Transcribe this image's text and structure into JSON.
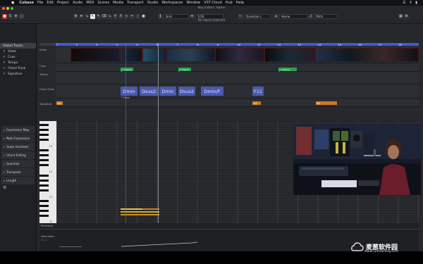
{
  "menubar": {
    "app": "Cubase",
    "items": [
      "File",
      "Edit",
      "Project",
      "Audio",
      "MIDI",
      "Scores",
      "Media",
      "Transport",
      "Studio",
      "Workspaces",
      "Window",
      "VST Cloud",
      "Hub",
      "Help"
    ]
  },
  "window": {
    "title": "Key Editor: Hame",
    "status": "No Object Selected"
  },
  "toolbar": {
    "grid_label": "Grid",
    "quant_value": "1/16",
    "quantize_label": "Quantize L",
    "home_label": "Home",
    "pitch_label": "Pitch"
  },
  "left_panel": {
    "header": "Global Tracks",
    "tracks": [
      "Video",
      "Cues",
      "Tempo",
      "Chord Track",
      "Signature"
    ],
    "rows": [
      "Expression Map",
      "Note Expression",
      "Scale Assistant",
      "Chord Editing",
      "Quantize",
      "Transpose",
      "Length"
    ]
  },
  "ruler": {
    "bars": [
      "1",
      "2",
      "3",
      "4",
      "5",
      "6",
      "7",
      "8",
      "9",
      "10",
      "11",
      "12",
      "13",
      "14",
      "15",
      "16",
      "17",
      "18"
    ]
  },
  "lanes": {
    "video": "Video",
    "cues": "Cues",
    "tempo": "Tempo",
    "chord": "Chord Track",
    "signature": "Signature"
  },
  "markers": [
    {
      "label": "1. Theme"
    },
    {
      "label": "2. Theme"
    },
    {
      "label": "3. Reprise"
    }
  ],
  "chords": [
    "Dmin",
    "Dsus2",
    "Dmin",
    "Dsus2",
    "Dmin/F",
    "F11"
  ],
  "chord_sub": "F Major",
  "signatures": [
    "4/4",
    "2/4",
    "3/4"
  ],
  "keyboard": {
    "labels": [
      "C5",
      "C4",
      "C3",
      "C2"
    ]
  },
  "bottom": {
    "lane1": "Pitchbend",
    "lane2": "Modulation",
    "cc": "CC 1"
  },
  "watermark": {
    "title": "麦葱软件园",
    "url": "www.52maicong.com"
  }
}
